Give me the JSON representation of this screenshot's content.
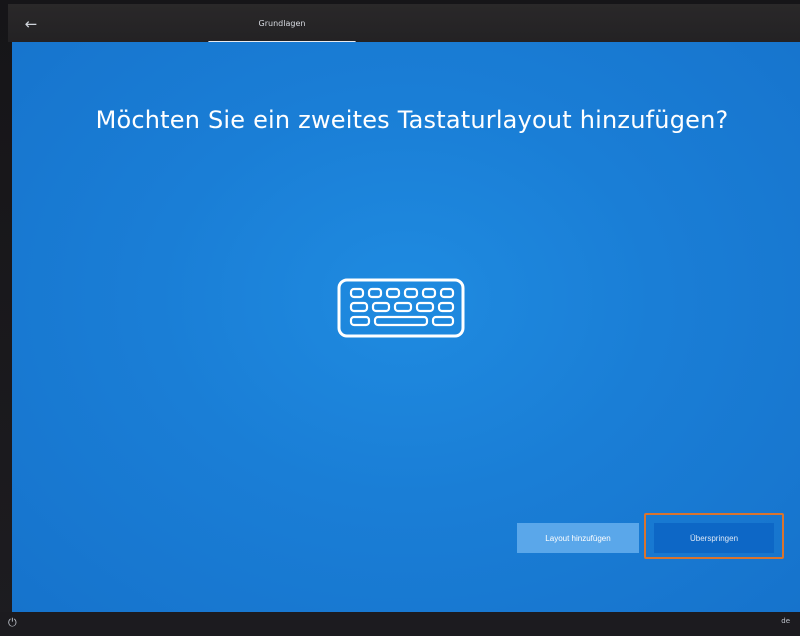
{
  "header": {
    "back_icon": "back-arrow-icon",
    "tab_label": "Grundlagen"
  },
  "main": {
    "title": "Möchten Sie ein zweites Tastaturlayout hinzufügen?",
    "illustration_icon": "keyboard-icon"
  },
  "actions": {
    "add_layout_label": "Layout hinzufügen",
    "skip_label": "Überspringen",
    "skip_highlight_color": "#d9742e"
  },
  "footer": {
    "power_icon": "accessibility-icon",
    "language": "de"
  },
  "colors": {
    "background": "#1a7ed6",
    "add_button": "#5aa7ea",
    "skip_button": "#0d67c6"
  }
}
